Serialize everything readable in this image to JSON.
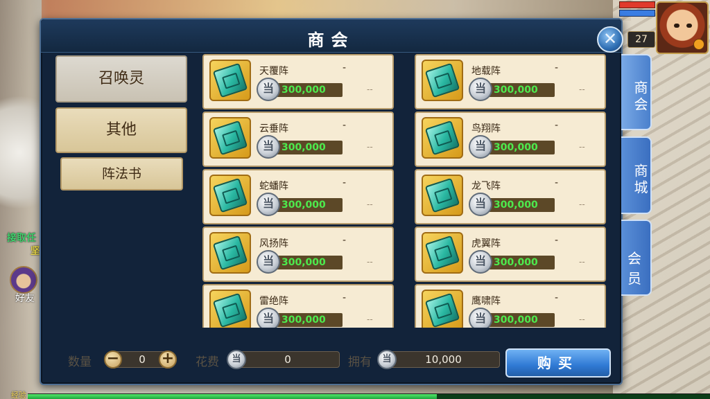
{
  "background": {
    "left_text_1": "接取任",
    "left_text_2": "坚",
    "friend_label": "好友",
    "exp_label": "经验",
    "exp_fraction": 0.6
  },
  "player": {
    "level": "27",
    "hp_fraction": 1.0,
    "mp_fraction": 1.0
  },
  "panel": {
    "title": "商会",
    "close_glyph": "✕"
  },
  "categories": [
    {
      "label": "召唤灵"
    },
    {
      "label": "其他"
    },
    {
      "label": "阵法书"
    }
  ],
  "items": [
    {
      "name": "天覆阵",
      "price": "300,000",
      "stock": "-",
      "owned": "--"
    },
    {
      "name": "地载阵",
      "price": "300,000",
      "stock": "-",
      "owned": "--"
    },
    {
      "name": "云垂阵",
      "price": "300,000",
      "stock": "-",
      "owned": "--"
    },
    {
      "name": "鸟翔阵",
      "price": "300,000",
      "stock": "-",
      "owned": "--"
    },
    {
      "name": "蛇蟠阵",
      "price": "300,000",
      "stock": "-",
      "owned": "--"
    },
    {
      "name": "龙飞阵",
      "price": "300,000",
      "stock": "-",
      "owned": "--"
    },
    {
      "name": "风扬阵",
      "price": "300,000",
      "stock": "-",
      "owned": "--"
    },
    {
      "name": "虎翼阵",
      "price": "300,000",
      "stock": "-",
      "owned": "--"
    },
    {
      "name": "雷绝阵",
      "price": "300,000",
      "stock": "-",
      "owned": "--"
    },
    {
      "name": "鹰啸阵",
      "price": "300,000",
      "stock": "-",
      "owned": "--"
    }
  ],
  "coin_glyph": "当",
  "footer": {
    "quantity_label": "数量",
    "quantity_value": "0",
    "minus": "−",
    "plus": "+",
    "cost_label": "花费",
    "cost_value": "0",
    "owned_label": "拥有",
    "owned_value": "10,000",
    "buy_label": "购买"
  },
  "side_tabs": [
    {
      "label": "商会"
    },
    {
      "label": "商城"
    },
    {
      "label": "会员"
    }
  ]
}
